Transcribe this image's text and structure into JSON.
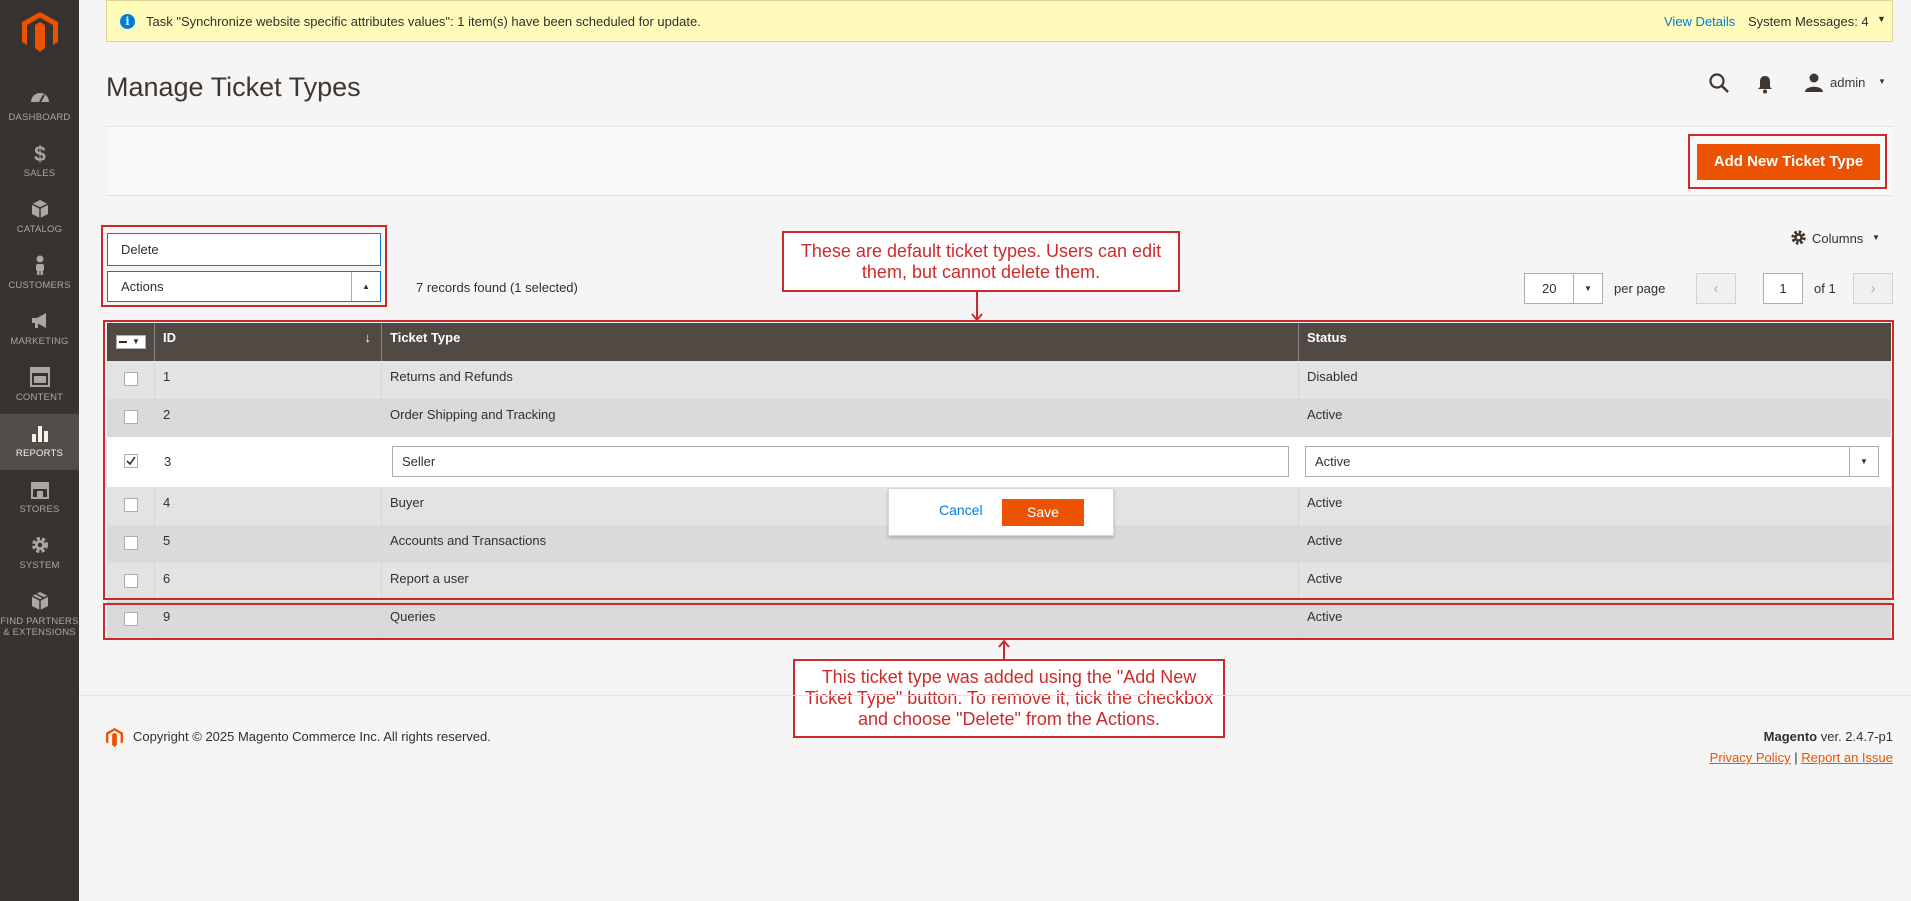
{
  "colors": {
    "accent": "#eb5202",
    "sidebar": "#373330",
    "annotation": "#cc2b2b",
    "link": "#007bdb"
  },
  "sidebar": {
    "items": [
      {
        "label": "DASHBOARD",
        "icon": "dashboard-icon"
      },
      {
        "label": "SALES",
        "icon": "dollar-icon"
      },
      {
        "label": "CATALOG",
        "icon": "cube-icon"
      },
      {
        "label": "CUSTOMERS",
        "icon": "person-icon"
      },
      {
        "label": "MARKETING",
        "icon": "megaphone-icon"
      },
      {
        "label": "CONTENT",
        "icon": "layout-icon"
      },
      {
        "label": "REPORTS",
        "icon": "bar-chart-icon"
      },
      {
        "label": "STORES",
        "icon": "store-icon"
      },
      {
        "label": "SYSTEM",
        "icon": "gear-icon"
      },
      {
        "label_line1": "FIND PARTNERS",
        "label_line2": "& EXTENSIONS",
        "icon": "box-icon"
      }
    ]
  },
  "message": {
    "text": "Task \"Synchronize website specific attributes values\": 1 item(s) have been scheduled for update.",
    "view_details": "View Details",
    "system_messages": "System Messages: 4"
  },
  "header": {
    "title": "Manage Ticket Types",
    "user": "admin"
  },
  "page_actions": {
    "add_button": "Add New Ticket Type"
  },
  "grid_controls": {
    "mass_action_option": "Delete",
    "mass_action_label": "Actions",
    "records_found": "7 records found (1 selected)",
    "columns_label": "Columns",
    "per_page_value": "20",
    "per_page_label": "per page",
    "current_page": "1",
    "of_pages": "of 1"
  },
  "grid": {
    "headers": {
      "id": "ID",
      "ticket_type": "Ticket Type",
      "status": "Status"
    },
    "rows": [
      {
        "id": "1",
        "ticket_type": "Returns and Refunds",
        "status": "Disabled"
      },
      {
        "id": "2",
        "ticket_type": "Order Shipping and Tracking",
        "status": "Active"
      },
      {
        "id": "3",
        "ticket_type": "Seller",
        "status": "Active"
      },
      {
        "id": "4",
        "ticket_type": "Buyer",
        "status": "Active"
      },
      {
        "id": "5",
        "ticket_type": "Accounts and Transactions",
        "status": "Active"
      },
      {
        "id": "6",
        "ticket_type": "Report a user",
        "status": "Active"
      },
      {
        "id": "9",
        "ticket_type": "Queries",
        "status": "Active"
      }
    ],
    "edit_cancel": "Cancel",
    "edit_save": "Save"
  },
  "annotations": {
    "top_note_line1": "These are default ticket types. Users can edit",
    "top_note_line2": "them, but cannot delete them.",
    "bottom_note_line1": "This ticket type was added using the \"Add New",
    "bottom_note_line2": "Ticket Type\" button. To remove it, tick the checkbox",
    "bottom_note_line3": "and choose \"Delete\" from the Actions."
  },
  "footer": {
    "copyright": "Copyright © 2025 Magento Commerce Inc. All rights reserved.",
    "brand": "Magento",
    "version": " ver. 2.4.7-p1",
    "privacy": "Privacy Policy",
    "separator": "|",
    "report": "Report an Issue"
  }
}
